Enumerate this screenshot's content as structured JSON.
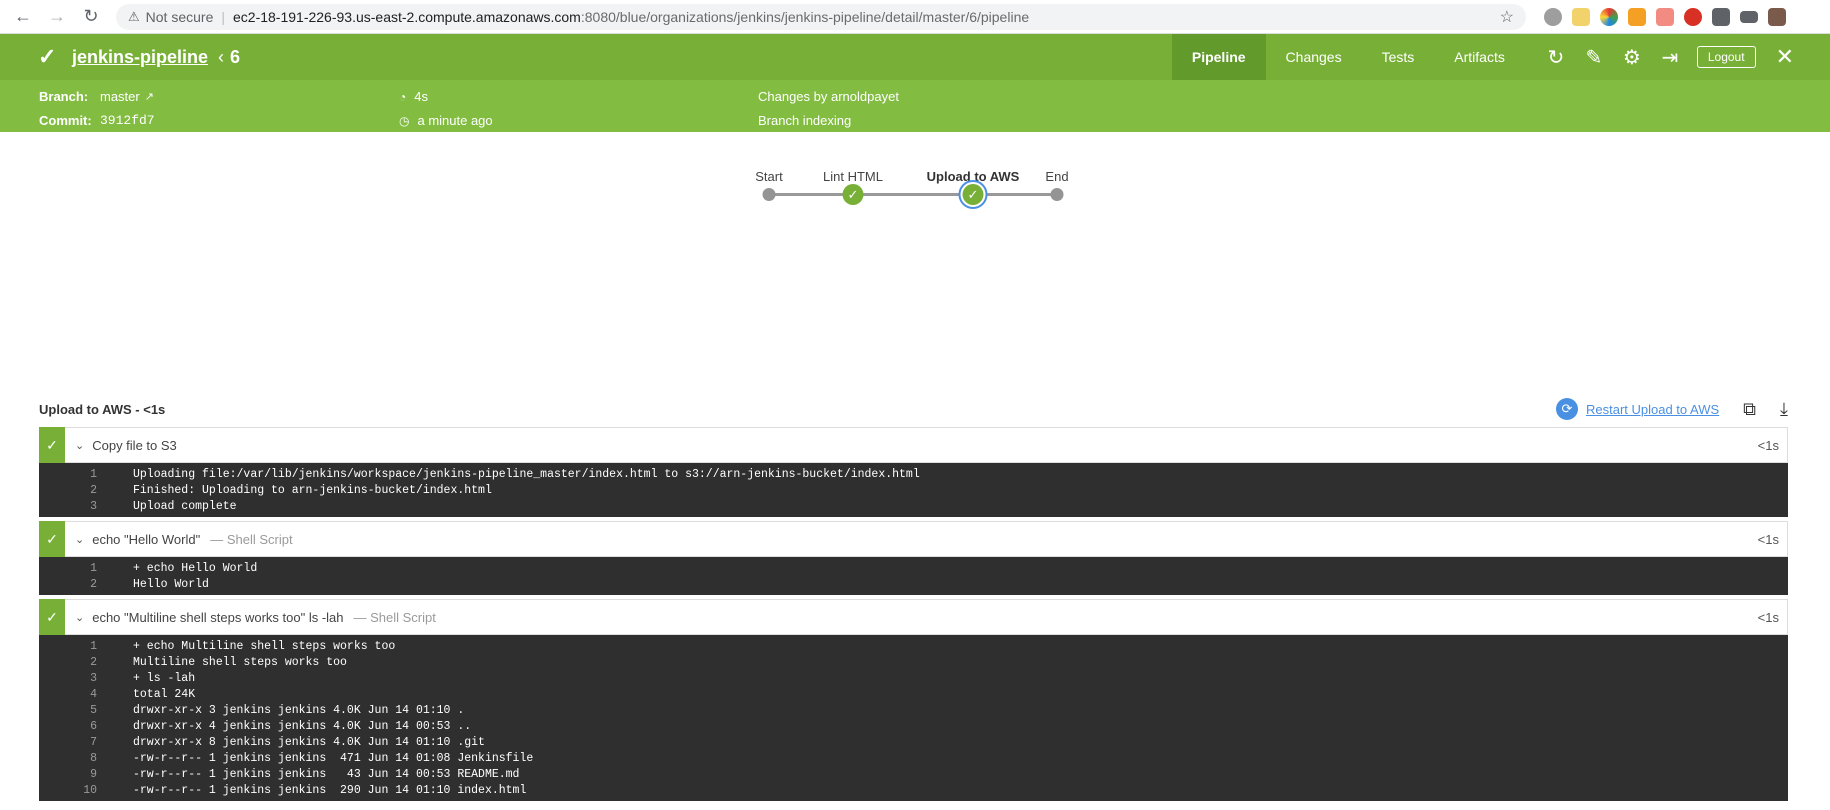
{
  "browser": {
    "security": "Not secure",
    "url_host": "ec2-18-191-226-93.us-east-2.compute.amazonaws.com",
    "url_path": ":8080/blue/organizations/jenkins/jenkins-pipeline/detail/master/6/pipeline"
  },
  "header": {
    "pipeline_name": "jenkins-pipeline",
    "run_number": "6",
    "tabs": [
      "Pipeline",
      "Changes",
      "Tests",
      "Artifacts"
    ],
    "active_tab": "Pipeline",
    "logout_label": "Logout"
  },
  "run_info": {
    "branch_label": "Branch:",
    "branch_value": "master",
    "commit_label": "Commit:",
    "commit_value": "3912fd7",
    "duration": "4s",
    "started": "a minute ago",
    "changes_by": "Changes by arnoldpayet",
    "cause": "Branch indexing"
  },
  "graph": {
    "stages": [
      "Start",
      "Lint HTML",
      "Upload to AWS",
      "End"
    ],
    "selected": "Upload to AWS"
  },
  "stage_detail": {
    "title": "Upload to AWS - <1s",
    "restart_label": "Restart Upload to AWS"
  },
  "steps": [
    {
      "name": "Copy file to S3",
      "kind": "",
      "duration": "<1s",
      "log": [
        "Uploading file:/var/lib/jenkins/workspace/jenkins-pipeline_master/index.html to s3://arn-jenkins-bucket/index.html",
        "Finished: Uploading to arn-jenkins-bucket/index.html",
        "Upload complete"
      ]
    },
    {
      "name": "echo \"Hello World\"",
      "kind": "— Shell Script",
      "duration": "<1s",
      "log": [
        "+ echo Hello World",
        "Hello World"
      ]
    },
    {
      "name": "echo \"Multiline shell steps works too\" ls -lah",
      "kind": "— Shell Script",
      "duration": "<1s",
      "log": [
        "+ echo Multiline shell steps works too",
        "Multiline shell steps works too",
        "+ ls -lah",
        "total 24K",
        "drwxr-xr-x 3 jenkins jenkins 4.0K Jun 14 01:10 .",
        "drwxr-xr-x 4 jenkins jenkins 4.0K Jun 14 00:53 ..",
        "drwxr-xr-x 8 jenkins jenkins 4.0K Jun 14 01:10 .git",
        "-rw-r--r-- 1 jenkins jenkins  471 Jun 14 01:08 Jenkinsfile",
        "-rw-r--r-- 1 jenkins jenkins   43 Jun 14 00:53 README.md",
        "-rw-r--r-- 1 jenkins jenkins  290 Jun 14 01:10 index.html"
      ]
    }
  ],
  "colors": {
    "header_green": "#78b037",
    "subheader_green": "#82bd42",
    "accent_blue": "#4a90e2",
    "log_bg": "#2f2f2f"
  }
}
